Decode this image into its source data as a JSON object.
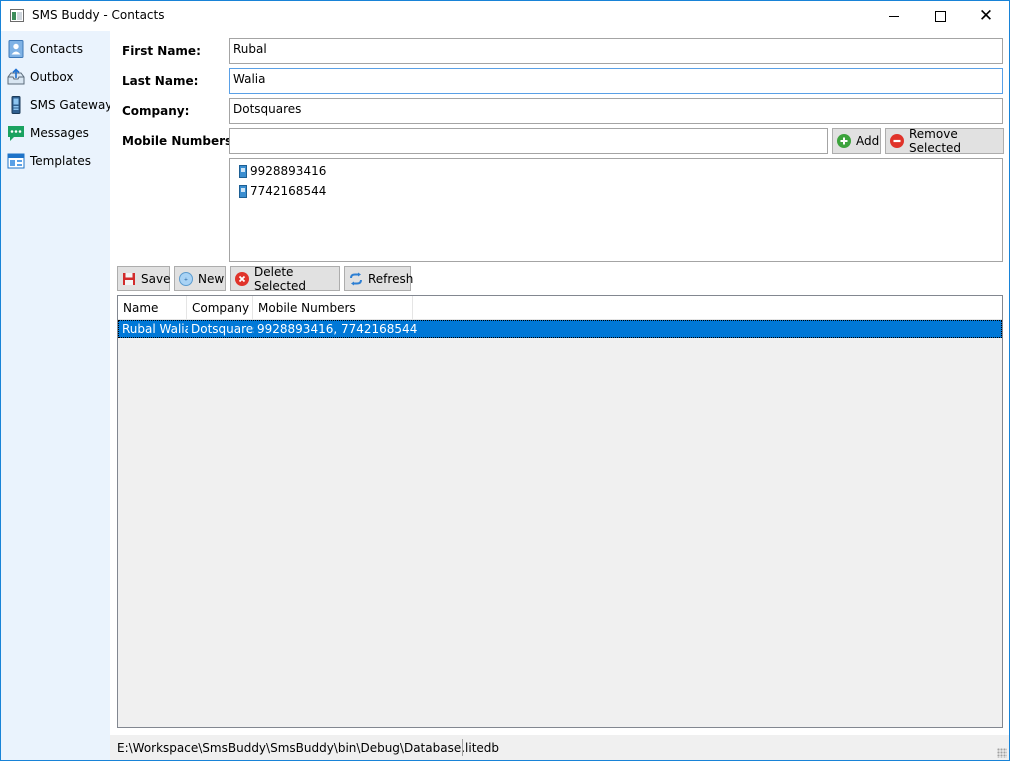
{
  "window": {
    "title": "SMS Buddy - Contacts",
    "accent": "#1883d7",
    "minimize_glyph": "—",
    "maximize_glyph": "☐",
    "close_glyph": "✕"
  },
  "sidebar": {
    "items": [
      {
        "label": "Contacts",
        "icon": "contacts-icon"
      },
      {
        "label": "Outbox",
        "icon": "outbox-icon"
      },
      {
        "label": "SMS Gateway",
        "icon": "sms-gateway-icon"
      },
      {
        "label": "Messages",
        "icon": "messages-icon"
      },
      {
        "label": "Templates",
        "icon": "templates-icon"
      }
    ]
  },
  "form": {
    "first_name_label": "First Name:",
    "first_name_value": "Rubal",
    "last_name_label": "Last Name:",
    "last_name_value": "Walia",
    "company_label": "Company:",
    "company_value": "Dotsquares",
    "mobile_label": "Mobile Numbers:",
    "mobile_input_value": "",
    "add_label": "Add",
    "remove_label": "Remove Selected",
    "mobile_numbers": [
      "9928893416",
      "7742168544"
    ]
  },
  "toolbar": {
    "save_label": "Save",
    "new_label": "New",
    "delete_label": "Delete Selected",
    "refresh_label": "Refresh"
  },
  "grid": {
    "columns": [
      "Name",
      "Company",
      "Mobile Numbers"
    ],
    "rows": [
      {
        "name": "Rubal Walia",
        "company": "Dotsquares",
        "mobile": "9928893416, 7742168544",
        "selected": true
      }
    ],
    "selection_color": "#0078d7"
  },
  "status": {
    "path": "E:\\Workspace\\SmsBuddy\\SmsBuddy\\bin\\Debug\\Database.litedb"
  }
}
